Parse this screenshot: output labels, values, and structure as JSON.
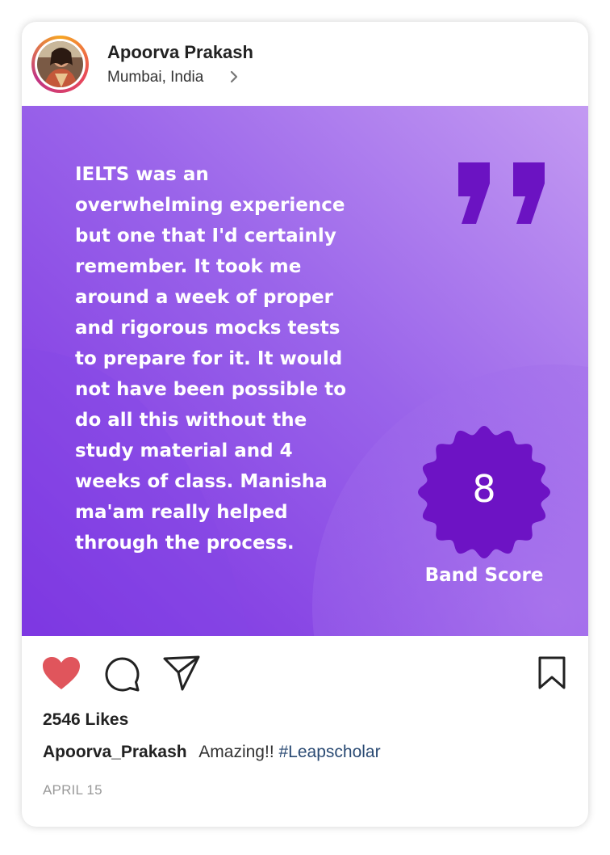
{
  "post": {
    "user_name": "Apoorva Prakash",
    "location": "Mumbai, India",
    "quote_text": "IELTS was an\noverwhelming experience\nbut one that I'd certainly\nremember. It took me\naround a week of proper\nand rigorous mocks tests\nto prepare for it. It would\nnot have been possible to\ndo all this without the\nstudy material and 4\nweeks of class. Manisha\nma'am really helped\nthrough the process.",
    "band_score": "8",
    "band_label": "Band Score",
    "likes": "2546 Likes",
    "caption_user": "Apoorva_Prakash",
    "caption_text": "Amazing!!",
    "caption_tag": "#Leapscholar",
    "date": "APRIL 15"
  },
  "icons": {
    "like": "heart-icon",
    "comment": "comment-icon",
    "share": "send-icon",
    "save": "bookmark-icon",
    "location_more": "chevron-right-icon",
    "quote": "quote-icon",
    "badge": "badge-icon"
  },
  "colors": {
    "heart": "#e0555c",
    "purple_light": "#b98cf0",
    "purple_mid": "#8a4fe6",
    "purple_dark": "#6d13c4",
    "tag": "#2a4a73"
  }
}
